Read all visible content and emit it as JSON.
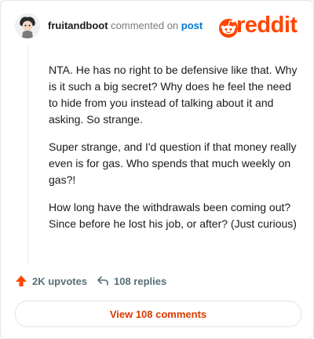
{
  "header": {
    "username": "fruitandboot",
    "action_text": "commented on",
    "post_link": "post"
  },
  "logo": {
    "text": "reddit",
    "color": "#ff4500"
  },
  "comment": {
    "paragraphs": [
      "NTA. He has no right to be defensive like that. Why is it such a big secret? Why does he feel the need to hide from you instead of talking about it and asking. So strange.",
      "Super strange, and I'd question if that money really even is for gas. Who spends that much weekly on gas?!",
      "How long have the withdrawals been coming out? Since before he lost his job, or after? (Just curious)"
    ]
  },
  "actions": {
    "upvotes_label": "2K upvotes",
    "replies_label": "108 replies",
    "upvote_icon": "upvote-arrow-icon",
    "reply_icon": "reply-arrow-icon"
  },
  "view_button": {
    "label": "View 108 comments"
  },
  "colors": {
    "accent": "#ff4500",
    "link": "#0079d3",
    "button_text": "#d93a00"
  }
}
